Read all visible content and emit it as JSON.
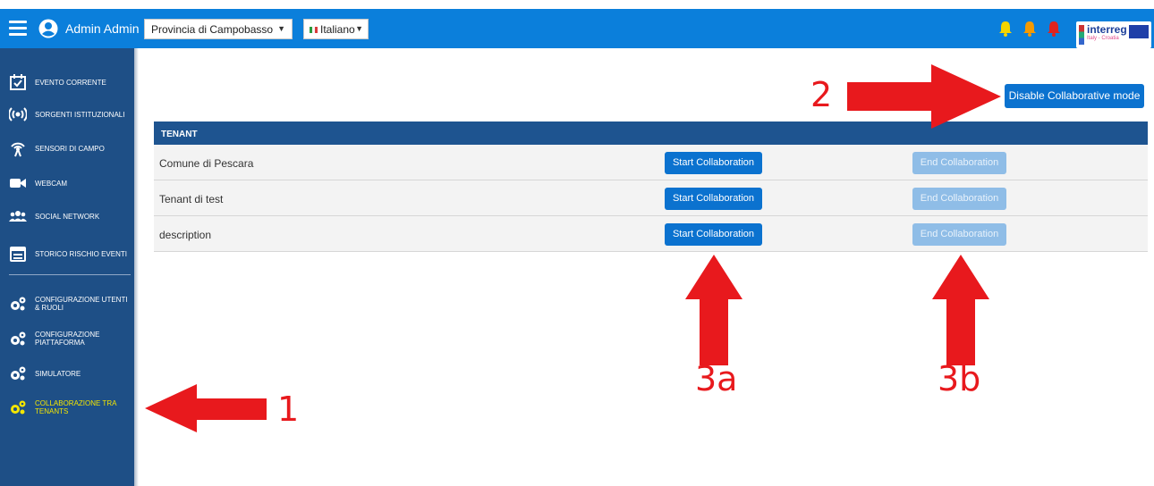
{
  "topbar": {
    "user_name": "Admin Admin",
    "province_select": "Provincia di Campobasso",
    "language_select": "Italiano",
    "logo_text": "interreg",
    "logo_subtext": "Italy - Croatia"
  },
  "sidebar": {
    "items": [
      {
        "label": "EVENTO CORRENTE",
        "icon": "calendar-check-icon"
      },
      {
        "label": "SORGENTI ISTITUZIONALI",
        "icon": "broadcast-icon"
      },
      {
        "label": "SENSORI DI CAMPO",
        "icon": "antenna-icon"
      },
      {
        "label": "WEBCAM",
        "icon": "video-camera-icon"
      },
      {
        "label": "SOCIAL NETWORK",
        "icon": "users-icon"
      },
      {
        "label": "STORICO RISCHIO EVENTI",
        "icon": "calendar-list-icon"
      },
      {
        "label": "CONFIGURAZIONE UTENTI & RUOLI",
        "icon": "gears-icon"
      },
      {
        "label": "CONFIGURAZIONE PIATTAFORMA",
        "icon": "gears-icon"
      },
      {
        "label": "SIMULATORE",
        "icon": "gears-icon"
      },
      {
        "label": "COLLABORAZIONE TRA TENANTS",
        "icon": "gears-icon",
        "active": true
      }
    ]
  },
  "main": {
    "disable_button": "Disable Collaborative mode",
    "table_header": "TENANT",
    "rows": [
      {
        "name": "Comune di Pescara",
        "start": "Start Collaboration",
        "end": "End Collaboration"
      },
      {
        "name": "Tenant di test",
        "start": "Start Collaboration",
        "end": "End Collaboration"
      },
      {
        "name": "description",
        "start": "Start Collaboration",
        "end": "End Collaboration"
      }
    ]
  },
  "annotations": {
    "label_1": "1",
    "label_2": "2",
    "label_3a": "3a",
    "label_3b": "3b",
    "color": "#e8191d"
  },
  "colors": {
    "topbar": "#0b7fdb",
    "sidebar": "#1e4f86",
    "active_item": "#f4e600",
    "primary_button": "#0b72cf",
    "disabled_button": "#8fbde7",
    "table_header": "#1e5490",
    "bell_yellow": "#f5d400",
    "bell_orange": "#f59a00",
    "bell_red": "#e0231e"
  }
}
